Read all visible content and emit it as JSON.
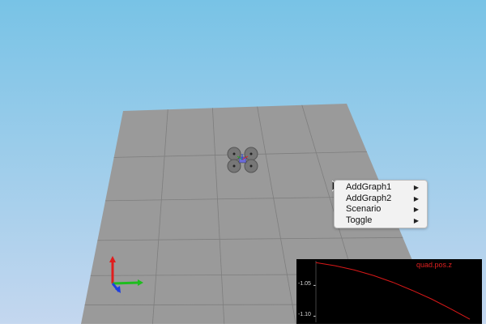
{
  "viewport": {
    "sky_top_color": "#78c3e6",
    "sky_bottom_color": "#c4d7ef",
    "ground_color": "#9a9a9a",
    "grid_color": "#7e7e7e",
    "vehicle": "quadrotor",
    "axes_colors": {
      "x": "#1fbd1f",
      "y": "#1e3fe0",
      "z": "#e01d1d"
    }
  },
  "context_menu": {
    "items": [
      {
        "label": "AddGraph1",
        "arrow": "▶"
      },
      {
        "label": "AddGraph2",
        "arrow": "▶"
      },
      {
        "label": "Scenario",
        "arrow": "▶"
      },
      {
        "label": "Toggle",
        "arrow": "▶"
      }
    ]
  },
  "graph": {
    "series_label": "quad.pos.z",
    "tick_labels": [
      "-1.05",
      "-1.10"
    ],
    "line_color": "#d81818",
    "background": "#000000"
  },
  "chart_data": {
    "type": "line",
    "series": [
      {
        "name": "quad.pos.z",
        "x": [
          0,
          1,
          2,
          3,
          4,
          5,
          6,
          7,
          8
        ],
        "values": [
          -1.013,
          -1.018,
          -1.025,
          -1.034,
          -1.045,
          -1.058,
          -1.072,
          -1.088,
          -1.105
        ]
      }
    ],
    "yticks": [
      -1.05,
      -1.1
    ],
    "ylim": [
      -1.11,
      -1.01
    ],
    "xlim": [
      0,
      8.5
    ]
  }
}
